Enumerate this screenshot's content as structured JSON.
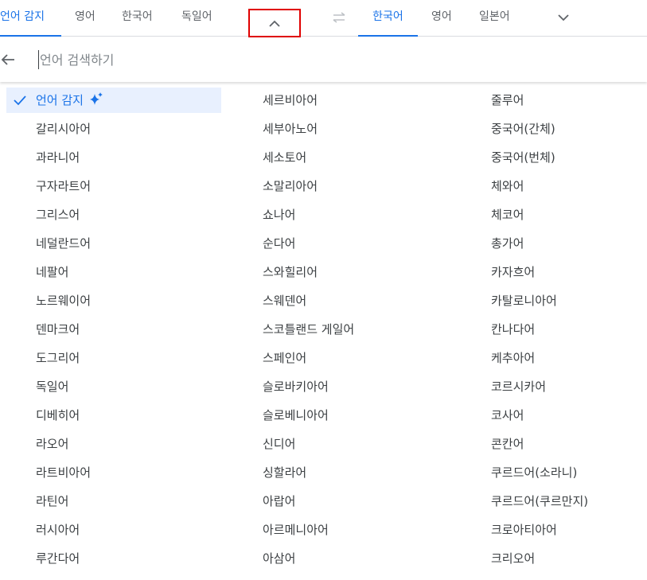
{
  "source_tabs": [
    {
      "label": "언어 감지",
      "active": true
    },
    {
      "label": "영어",
      "active": false
    },
    {
      "label": "한국어",
      "active": false
    },
    {
      "label": "독일어",
      "active": false
    }
  ],
  "target_tabs": [
    {
      "label": "한국어",
      "active": true
    },
    {
      "label": "영어",
      "active": false
    },
    {
      "label": "일본어",
      "active": false
    }
  ],
  "icons": {
    "collapse": "chevron-up-icon",
    "swap": "swap-arrows-icon",
    "more": "chevron-down-icon",
    "back": "arrow-left-icon",
    "check": "check-icon",
    "sparkle": "sparkle-icon"
  },
  "search": {
    "placeholder": "언어 검색하기",
    "value": ""
  },
  "languages": {
    "column1": [
      "언어 감지",
      "갈리시아어",
      "과라니어",
      "구자라트어",
      "그리스어",
      "네덜란드어",
      "네팔어",
      "노르웨이어",
      "덴마크어",
      "도그리어",
      "독일어",
      "디베히어",
      "라오어",
      "라트비아어",
      "라틴어",
      "러시아어",
      "루간다어"
    ],
    "column2": [
      "세르비아어",
      "세부아노어",
      "세소토어",
      "소말리아어",
      "쇼나어",
      "순다어",
      "스와힐리어",
      "스웨덴어",
      "스코틀랜드 게일어",
      "스페인어",
      "슬로바키아어",
      "슬로베니아어",
      "신디어",
      "싱할라어",
      "아랍어",
      "아르메니아어",
      "아삼어"
    ],
    "column3": [
      "줄루어",
      "중국어(간체)",
      "중국어(번체)",
      "체와어",
      "체코어",
      "총가어",
      "카자흐어",
      "카탈로니아어",
      "칸나다어",
      "케추아어",
      "코르시카어",
      "코사어",
      "콘칸어",
      "쿠르드어(소라니)",
      "쿠르드어(쿠르만지)",
      "크로아티아어",
      "크리오어"
    ],
    "selected": "언어 감지"
  },
  "colors": {
    "accent": "#1a73e8",
    "selected_bg": "#e8f0fe",
    "highlight_box": "#e00000",
    "text": "#3c4043"
  }
}
